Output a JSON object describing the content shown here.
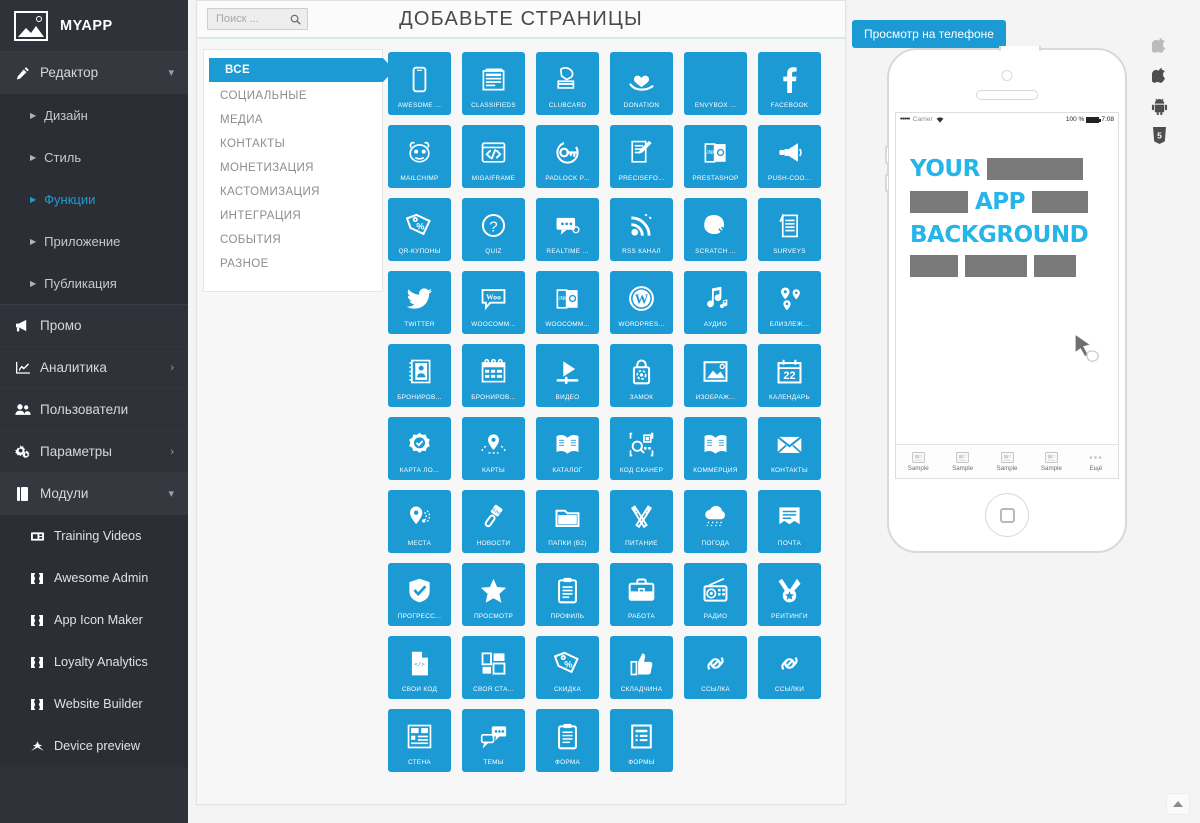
{
  "brand": {
    "name": "MYAPP",
    "logo_icon": "image-placeholder-icon"
  },
  "sidebar": {
    "editor": {
      "label": "Редактор",
      "icon": "pencil-icon",
      "chevron": "chevron-down-icon"
    },
    "editor_sub": [
      {
        "label": "Дизайн",
        "active": false
      },
      {
        "label": "Стиль",
        "active": false
      },
      {
        "label": "Функции",
        "active": true
      },
      {
        "label": "Приложение",
        "active": false
      },
      {
        "label": "Публикация",
        "active": false
      }
    ],
    "main": [
      {
        "label": "Промо",
        "icon": "megaphone-icon",
        "chevron": ""
      },
      {
        "label": "Аналитика",
        "icon": "chart-line-icon",
        "chevron": "chevron-right-icon"
      },
      {
        "label": "Пользователи",
        "icon": "users-icon",
        "chevron": ""
      },
      {
        "label": "Параметры",
        "icon": "gears-icon",
        "chevron": "chevron-right-icon"
      },
      {
        "label": "Модули",
        "icon": "book-icon",
        "chevron": "chevron-down-icon"
      }
    ],
    "modules": [
      {
        "label": "Training Videos",
        "icon": "video-icon"
      },
      {
        "label": "Awesome Admin",
        "icon": "puzzle-icon"
      },
      {
        "label": "App Icon Maker",
        "icon": "puzzle-icon"
      },
      {
        "label": "Loyalty Analytics",
        "icon": "puzzle-icon"
      },
      {
        "label": "Website Builder",
        "icon": "puzzle-icon"
      },
      {
        "label": "Device preview",
        "icon": "magic-icon"
      }
    ]
  },
  "center": {
    "title": "ДОБАВЬТЕ СТРАНИЦЫ",
    "search": {
      "placeholder": "Поиск ...",
      "value": "",
      "icon": "search-icon"
    },
    "categories": [
      {
        "label": "ВСЕ",
        "active": true
      },
      {
        "label": "СОЦИАЛЬНЫЕ",
        "active": false
      },
      {
        "label": "МЕДИА",
        "active": false
      },
      {
        "label": "КОНТАКТЫ",
        "active": false
      },
      {
        "label": "МОНЕТИЗАЦИЯ",
        "active": false
      },
      {
        "label": "КАСТОМИЗАЦИЯ",
        "active": false
      },
      {
        "label": "ИНТЕГРАЦИЯ",
        "active": false
      },
      {
        "label": "СОБЫТИЯ",
        "active": false
      },
      {
        "label": "РАЗНОЕ",
        "active": false
      }
    ],
    "tile_color": "#1b9ad4",
    "tiles": [
      {
        "label": "AWESOME ...",
        "icon": "mobile-phone-icon"
      },
      {
        "label": "CLASSIFIEDS",
        "icon": "newspaper-icon"
      },
      {
        "label": "CLUBCARD",
        "icon": "hand-card-icon"
      },
      {
        "label": "DONATION",
        "icon": "heart-hand-icon"
      },
      {
        "label": "ENVYBOX ...",
        "icon": "blank-icon"
      },
      {
        "label": "FACEBOOK",
        "icon": "facebook-icon"
      },
      {
        "label": "MAILCHIMP",
        "icon": "mailchimp-monkey-icon"
      },
      {
        "label": "MIGAIFRAME",
        "icon": "code-window-icon"
      },
      {
        "label": "PADLOCK P...",
        "icon": "key-circle-icon"
      },
      {
        "label": "PRECISEFO...",
        "icon": "form-pen-icon"
      },
      {
        "label": "PRESTASHOP",
        "icon": "link-card-icon"
      },
      {
        "label": "PUSH-COO...",
        "icon": "megaphone-push-icon"
      },
      {
        "label": "QR-КУПОНЫ",
        "icon": "tag-percent-icon"
      },
      {
        "label": "QUIZ",
        "icon": "question-circle-icon"
      },
      {
        "label": "REALTIME ...",
        "icon": "chat-bubble-icon"
      },
      {
        "label": "RSS КАНАЛ",
        "icon": "rss-icon"
      },
      {
        "label": "SCRATCH ...",
        "icon": "scratch-card-icon"
      },
      {
        "label": "SURVEYS",
        "icon": "survey-pen-icon"
      },
      {
        "label": "TWITTER",
        "icon": "twitter-icon"
      },
      {
        "label": "WOOCOMM...",
        "icon": "woo-bubble-icon"
      },
      {
        "label": "WOOCOMM...",
        "icon": "link-card-icon"
      },
      {
        "label": "WORDPRES...",
        "icon": "wordpress-icon"
      },
      {
        "label": "АУДИО",
        "icon": "music-notes-icon"
      },
      {
        "label": "БЛИЗЛЕЖ...",
        "icon": "map-pins-icon"
      },
      {
        "label": "БРОНИРОВ...",
        "icon": "contact-card-icon"
      },
      {
        "label": "БРОНИРОВ...",
        "icon": "calendar-grid-icon"
      },
      {
        "label": "ВИДЕО",
        "icon": "video-play-icon"
      },
      {
        "label": "ЗАМОК",
        "icon": "padlock-icon"
      },
      {
        "label": "ИЗОБРАЖ...",
        "icon": "picture-icon"
      },
      {
        "label": "КАЛЕНДАРЬ",
        "icon": "calendar-22-icon",
        "icon_text": "22"
      },
      {
        "label": "КАРТА ЛО...",
        "icon": "badge-check-icon"
      },
      {
        "label": "КАРТЫ",
        "icon": "map-pin-route-icon"
      },
      {
        "label": "КАТАЛОГ",
        "icon": "open-book-icon"
      },
      {
        "label": "КОД СКАНЕР",
        "icon": "barcode-scan-icon"
      },
      {
        "label": "КОММЕРЦИЯ",
        "icon": "open-book-icon"
      },
      {
        "label": "КОНТАКТЫ",
        "icon": "envelope-icon"
      },
      {
        "label": "МЕСТА",
        "icon": "pin-radar-icon"
      },
      {
        "label": "НОВОСТИ",
        "icon": "microphone-icon"
      },
      {
        "label": "ПАПКИ (B2)",
        "icon": "folder-icon"
      },
      {
        "label": "ПИТАНИЕ",
        "icon": "fork-knife-icon"
      },
      {
        "label": "ПОГОДА",
        "icon": "cloud-rain-icon"
      },
      {
        "label": "ПОЧТА",
        "icon": "mail-banner-icon"
      },
      {
        "label": "ПРОГРЕСС...",
        "icon": "shield-check-icon"
      },
      {
        "label": "ПРОСМОТР",
        "icon": "star-icon"
      },
      {
        "label": "ПРОФИЛЬ",
        "icon": "clipboard-icon"
      },
      {
        "label": "РАБОТА",
        "icon": "briefcase-icon"
      },
      {
        "label": "РАДИО",
        "icon": "radio-icon"
      },
      {
        "label": "РЕЙТИНГИ",
        "icon": "medal-icon"
      },
      {
        "label": "СВОЙ КОД",
        "icon": "code-file-icon"
      },
      {
        "label": "СВОЯ СТА...",
        "icon": "layout-blocks-icon"
      },
      {
        "label": "СКИДКА",
        "icon": "tag-percent-icon"
      },
      {
        "label": "СКЛАДЧИНА",
        "icon": "thumbs-up-icon"
      },
      {
        "label": "ССЫЛКА",
        "icon": "chain-link-icon"
      },
      {
        "label": "ССЫЛКИ",
        "icon": "chain-link-icon"
      },
      {
        "label": "СТЕНА",
        "icon": "wall-layout-icon"
      },
      {
        "label": "ТЕМЫ",
        "icon": "chat-threads-icon"
      },
      {
        "label": "ФОРМА",
        "icon": "clipboard-form-icon"
      },
      {
        "label": "ФОРМЫ",
        "icon": "form-list-icon"
      }
    ]
  },
  "preview": {
    "button_label": "Просмотр на телефоне",
    "platform_icons": [
      {
        "name": "apple-icon-light"
      },
      {
        "name": "apple-icon-dark"
      },
      {
        "name": "android-icon"
      },
      {
        "name": "html5-icon"
      }
    ],
    "phone": {
      "statusbar": {
        "signal_dots": "•••••",
        "carrier": "Carrier",
        "wifi_icon": "wifi-icon",
        "battery_percent": "100 %",
        "time": "7:08"
      },
      "screen_words": [
        "YOUR",
        "APP",
        "BACKGROUND"
      ],
      "cursor_icon": "cursor-hand-icon",
      "tabs": [
        {
          "label": "Sample",
          "icon": "page-icon"
        },
        {
          "label": "Sample",
          "icon": "page-icon"
        },
        {
          "label": "Sample",
          "icon": "page-icon"
        },
        {
          "label": "Sample",
          "icon": "page-icon"
        },
        {
          "label": "Ещё",
          "icon": "ellipsis-icon"
        }
      ]
    }
  },
  "scroll_top": {
    "icon": "caret-up-icon"
  }
}
